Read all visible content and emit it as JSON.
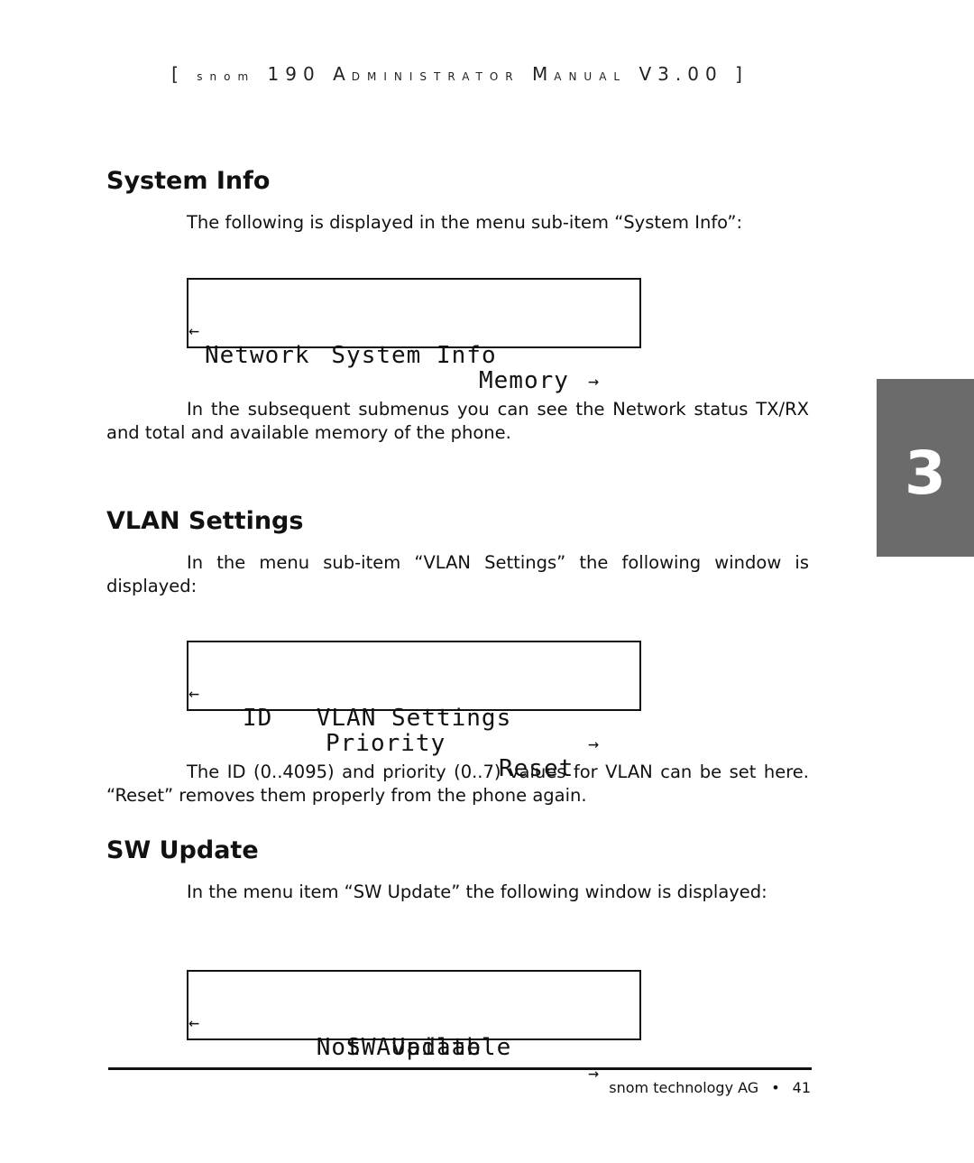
{
  "running_header": {
    "open_bracket": "[",
    "brand": "snom",
    "model": "190",
    "word1_initial": "A",
    "word1_rest": "dministrator",
    "word2_initial": "M",
    "word2_rest": "anual",
    "version": "V3.00",
    "close_bracket": "]"
  },
  "chapter_tab": {
    "number": "3",
    "color": "#6b6b6b"
  },
  "sections": [
    {
      "heading": "System Info",
      "text": "The following is displayed in the menu  sub-item “System Info”:",
      "lcd": {
        "left_arrow": "←",
        "title": "System Info",
        "right_arrow": "→",
        "options": [
          "Network",
          "Memory"
        ]
      },
      "after_text": "In the subsequent submenus you can see the Network status TX/RX and total and available memory of the phone."
    },
    {
      "heading": "VLAN Settings",
      "text": "In the menu sub-item “VLAN Settings” the following window is displayed:",
      "lcd": {
        "left_arrow": "←",
        "title": "VLAN Settings",
        "right_arrow": "→",
        "options": [
          "ID",
          "Priority",
          "Reset"
        ]
      },
      "after_text": "The ID (0..4095) and priority (0..7) values for VLAN can be set here. “Reset” removes them properly from the phone again."
    },
    {
      "heading": "SW Update",
      "text": "In the menu item “SW Update” the following window is displayed:",
      "lcd": {
        "left_arrow": "←",
        "title": "SW Update",
        "right_arrow": "→",
        "status": "Not Available"
      }
    }
  ],
  "footer": {
    "company": "snom technology AG",
    "bullet": "•",
    "page_number": "41"
  }
}
